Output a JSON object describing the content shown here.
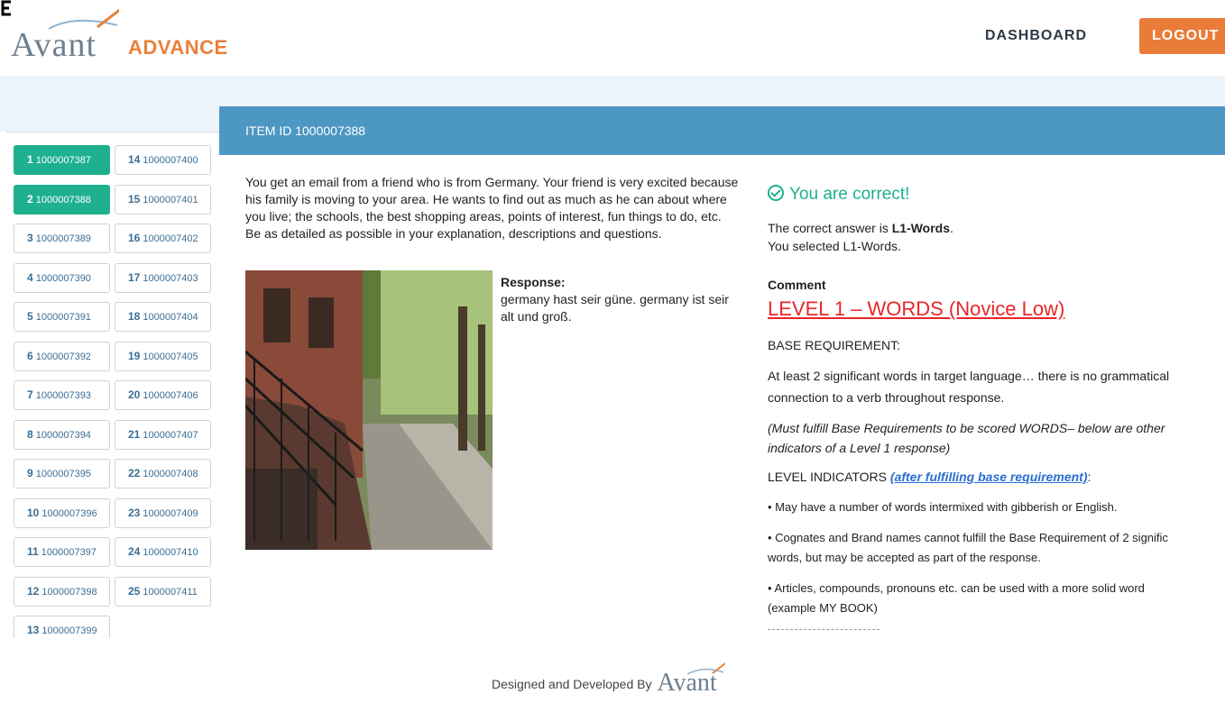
{
  "header": {
    "logo_brand": "Avant",
    "logo_product": "ADVANCE",
    "nav_dashboard": "DASHBOARD",
    "nav_logout": "LOGOUT"
  },
  "colors": {
    "accent_green": "#1fb08f",
    "header_blue": "#4d97c4",
    "brand_orange": "#e8813a",
    "level_red": "#e8262a"
  },
  "sidebar": {
    "items": [
      {
        "num": "1",
        "id": "1000007387",
        "active": true
      },
      {
        "num": "14",
        "id": "1000007400",
        "active": false
      },
      {
        "num": "2",
        "id": "1000007388",
        "active": true
      },
      {
        "num": "15",
        "id": "1000007401",
        "active": false
      },
      {
        "num": "3",
        "id": "1000007389",
        "active": false
      },
      {
        "num": "16",
        "id": "1000007402",
        "active": false
      },
      {
        "num": "4",
        "id": "1000007390",
        "active": false
      },
      {
        "num": "17",
        "id": "1000007403",
        "active": false
      },
      {
        "num": "5",
        "id": "1000007391",
        "active": false
      },
      {
        "num": "18",
        "id": "1000007404",
        "active": false
      },
      {
        "num": "6",
        "id": "1000007392",
        "active": false
      },
      {
        "num": "19",
        "id": "1000007405",
        "active": false
      },
      {
        "num": "7",
        "id": "1000007393",
        "active": false
      },
      {
        "num": "20",
        "id": "1000007406",
        "active": false
      },
      {
        "num": "8",
        "id": "1000007394",
        "active": false
      },
      {
        "num": "21",
        "id": "1000007407",
        "active": false
      },
      {
        "num": "9",
        "id": "1000007395",
        "active": false
      },
      {
        "num": "22",
        "id": "1000007408",
        "active": false
      },
      {
        "num": "10",
        "id": "1000007396",
        "active": false
      },
      {
        "num": "23",
        "id": "1000007409",
        "active": false
      },
      {
        "num": "11",
        "id": "1000007397",
        "active": false
      },
      {
        "num": "24",
        "id": "1000007410",
        "active": false
      },
      {
        "num": "12",
        "id": "1000007398",
        "active": false
      },
      {
        "num": "25",
        "id": "1000007411",
        "active": false
      },
      {
        "num": "13",
        "id": "1000007399",
        "active": false
      }
    ]
  },
  "item": {
    "title": "ITEM ID 1000007388",
    "prompt": "You get an email from a friend who is from Germany. Your friend is very excited because his family is moving to your area. He wants to find out as much as he can about where you live; the schools, the best shopping areas, points of interest, fun things to do, etc. Be as detailed as possible in your explanation, descriptions and questions.",
    "response_label": "Response:",
    "response_text": "germany hast seir güne. germany ist seir alt und groß."
  },
  "result": {
    "status": "You are correct!",
    "correct_prefix": "The correct answer is ",
    "correct_value": "L1-Words",
    "correct_suffix": ".",
    "selected": "You selected L1-Words.",
    "comment_label": "Comment",
    "level_title": "LEVEL 1 – WORDS (Novice Low)",
    "base_requirement_label": "BASE REQUIREMENT:",
    "base_requirement_text_1": "At least 2 significant words in target language… there is no grammatical",
    "base_requirement_text_2": "connection to a verb throughout response.",
    "note_1": "(Must fulfill Base Requirements to be scored WORDS– below are other",
    "note_2": "indicators of a Level 1 response)",
    "indicators_label": "LEVEL INDICATORS ",
    "indicators_link": "(after fulfilling base requirement)",
    "indicators_suffix": ":",
    "bullet_1": "• May have a number of words intermixed with gibberish or English.",
    "bullet_2a": "• Cognates and Brand names cannot fulfill the Base Requirement of 2 signific",
    "bullet_2b": "words, but may be accepted as part of the response.",
    "bullet_3a": "• Articles, compounds, pronouns etc. can be used with a more solid word",
    "bullet_3b": "(example MY BOOK)"
  },
  "footer": {
    "text": "Designed and Developed By",
    "brand": "Avant"
  }
}
